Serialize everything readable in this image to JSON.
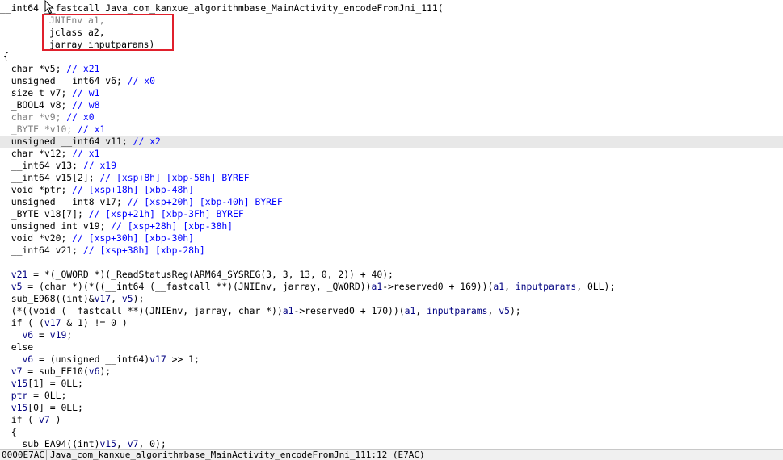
{
  "header": {
    "line1": [
      "__int64 ",
      "__fastcall",
      " Java_com_kanxue_algorithmbase_MainActivity_encodeFromJni_111("
    ],
    "param1": "JNIEnv a1,",
    "param2": "jclass a2,",
    "param3": "jarray inputparams)",
    "brace_open": "{"
  },
  "decls": [
    {
      "code": "char *v5; ",
      "comment": "// x21",
      "hl": false
    },
    {
      "code": "unsigned __int64 v6; ",
      "comment": "// x0",
      "hl": false
    },
    {
      "code": "size_t v7; ",
      "comment": "// w1",
      "hl": false
    },
    {
      "code": "_BOOL4 v8; ",
      "comment": "// w8",
      "hl": false
    },
    {
      "code": "char *v9; ",
      "comment": "// x0",
      "hl": false
    },
    {
      "code": "_BYTE *v10; ",
      "comment": "// x1",
      "hl": false
    },
    {
      "code": "unsigned __int64 v11; ",
      "comment": "// x2",
      "hl": true
    },
    {
      "code": "char *v12; ",
      "comment": "// x1",
      "hl": false
    },
    {
      "code": "__int64 v13; ",
      "comment": "// x19",
      "hl": false
    },
    {
      "code": "__int64 v15[2]; ",
      "comment": "// [xsp+8h] [xbp-58h] BYREF",
      "hl": false
    },
    {
      "code": "void *ptr; ",
      "comment": "// [xsp+18h] [xbp-48h]",
      "hl": false
    },
    {
      "code": "unsigned __int8 v17; ",
      "comment": "// [xsp+20h] [xbp-40h] BYREF",
      "hl": false
    },
    {
      "code": "_BYTE v18[7]; ",
      "comment": "// [xsp+21h] [xbp-3Fh] BYREF",
      "hl": false
    },
    {
      "code": "unsigned int v19; ",
      "comment": "// [xsp+28h] [xbp-38h]",
      "hl": false
    },
    {
      "code": "void *v20; ",
      "comment": "// [xsp+30h] [xbp-30h]",
      "hl": false
    },
    {
      "code": "__int64 v21; ",
      "comment": "// [xsp+38h] [xbp-28h]",
      "hl": false
    }
  ],
  "body": [
    [
      [
        "v",
        "v21"
      ],
      [
        "t",
        " = *(_QWORD *)(_ReadStatusReg(ARM64_SYSREG(3, 3, 13, 0, 2)) + 40);"
      ]
    ],
    [
      [
        "v",
        "v5"
      ],
      [
        "t",
        " = (char *)(*((__int64 (__fastcall **)(JNIEnv, jarray, _QWORD))"
      ],
      [
        "v",
        "a1"
      ],
      [
        "t",
        "->reserved0 + 169))("
      ],
      [
        "v",
        "a1"
      ],
      [
        "t",
        ", "
      ],
      [
        "v",
        "inputparams"
      ],
      [
        "t",
        ", 0LL);"
      ]
    ],
    [
      [
        "t",
        "sub_E968((int)&"
      ],
      [
        "v",
        "v17"
      ],
      [
        "t",
        ", "
      ],
      [
        "v",
        "v5"
      ],
      [
        "t",
        ");"
      ]
    ],
    [
      [
        "t",
        "(*((void (__fastcall **)(JNIEnv, jarray, char *))"
      ],
      [
        "v",
        "a1"
      ],
      [
        "t",
        "->reserved0 + 170))("
      ],
      [
        "v",
        "a1"
      ],
      [
        "t",
        ", "
      ],
      [
        "v",
        "inputparams"
      ],
      [
        "t",
        ", "
      ],
      [
        "v",
        "v5"
      ],
      [
        "t",
        ");"
      ]
    ],
    [
      [
        "t",
        "if ( ("
      ],
      [
        "v",
        "v17"
      ],
      [
        "t",
        " & 1) != 0 )"
      ]
    ],
    [
      [
        "t",
        "  "
      ],
      [
        "v",
        "v6"
      ],
      [
        "t",
        " = "
      ],
      [
        "v",
        "v19"
      ],
      [
        "t",
        ";"
      ]
    ],
    [
      [
        "t",
        "else"
      ]
    ],
    [
      [
        "t",
        "  "
      ],
      [
        "v",
        "v6"
      ],
      [
        "t",
        " = (unsigned __int64)"
      ],
      [
        "v",
        "v17"
      ],
      [
        "t",
        " >> 1;"
      ]
    ],
    [
      [
        "v",
        "v7"
      ],
      [
        "t",
        " = sub_EE10("
      ],
      [
        "v",
        "v6"
      ],
      [
        "t",
        ");"
      ]
    ],
    [
      [
        "v",
        "v15"
      ],
      [
        "t",
        "[1] = 0LL;"
      ]
    ],
    [
      [
        "v",
        "ptr"
      ],
      [
        "t",
        " = 0LL;"
      ]
    ],
    [
      [
        "v",
        "v15"
      ],
      [
        "t",
        "[0] = 0LL;"
      ]
    ],
    [
      [
        "t",
        "if ( "
      ],
      [
        "v",
        "v7"
      ],
      [
        "t",
        " )"
      ]
    ],
    [
      [
        "t",
        "{"
      ]
    ],
    [
      [
        "t",
        "  sub_EA94((int)"
      ],
      [
        "v",
        "v15"
      ],
      [
        "t",
        ", "
      ],
      [
        "v",
        "v7"
      ],
      [
        "t",
        ", 0);"
      ]
    ]
  ],
  "statusbar": {
    "address": "0000E7AC",
    "location": "Java_com_kanxue_algorithmbase_MainActivity_encodeFromJni_111:12 (E7AC)"
  },
  "colors": {
    "plain": "#000000",
    "comment": "#0000ff",
    "variable": "#000080",
    "highlight": "#e8e8e8",
    "annotation_box": "#e0202c"
  }
}
